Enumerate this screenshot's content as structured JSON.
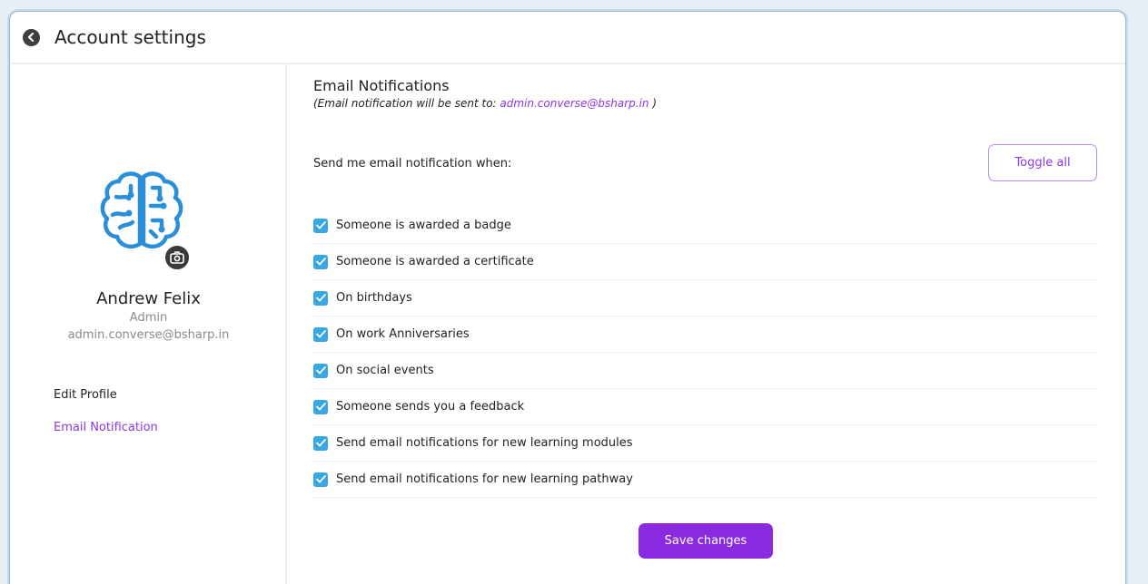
{
  "header": {
    "title": "Account settings"
  },
  "profile": {
    "name": "Andrew Felix",
    "role": "Admin",
    "email": "admin.converse@bsharp.in"
  },
  "sidebar": {
    "items": [
      {
        "label": "Edit Profile",
        "active": false
      },
      {
        "label": "Email Notification",
        "active": true
      }
    ]
  },
  "main": {
    "title": "Email Notifications",
    "subtitle_prefix": "(Email notification will be sent to: ",
    "subtitle_email": "admin.converse@bsharp.in",
    "subtitle_suffix": " )",
    "prompt": "Send me email notification when:",
    "toggle_all_label": "Toggle all",
    "options": [
      {
        "label": "Someone is awarded a badge",
        "checked": true
      },
      {
        "label": "Someone is awarded a certificate",
        "checked": true
      },
      {
        "label": "On birthdays",
        "checked": true
      },
      {
        "label": "On work Anniversaries",
        "checked": true
      },
      {
        "label": "On social events",
        "checked": true
      },
      {
        "label": "Someone sends you a feedback",
        "checked": true
      },
      {
        "label": "Send email notifications for new learning modules",
        "checked": true
      },
      {
        "label": "Send email notifications for new learning pathway",
        "checked": true
      }
    ],
    "save_label": "Save changes"
  },
  "colors": {
    "accent": "#8a2be2",
    "link": "#8a37e8",
    "checkbox": "#38a7e8",
    "avatar_stroke": "#2a8fd8"
  },
  "icons": {
    "back": "back-chevron-icon",
    "avatar": "brain-icon",
    "camera": "camera-icon",
    "checkbox": "checkmark-icon"
  }
}
